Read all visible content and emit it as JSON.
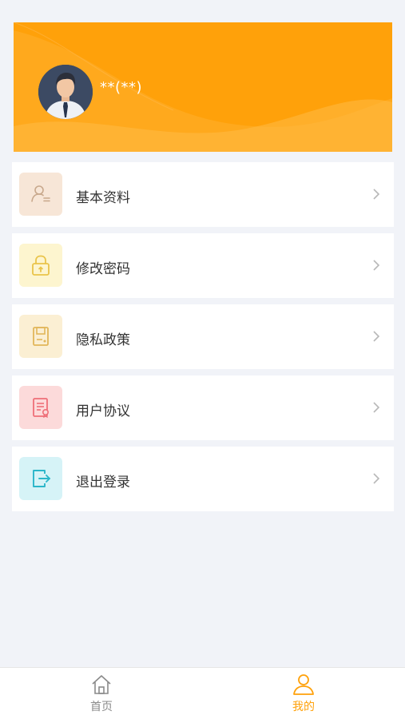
{
  "profile": {
    "username": "**(**)",
    "banner_color": "#ffa10a"
  },
  "menu": [
    {
      "label": "基本资料",
      "icon": "user-profile-icon",
      "bg": "#f7e6d7",
      "fg": "#c8a88c"
    },
    {
      "label": "修改密码",
      "icon": "lock-icon",
      "bg": "#fdf5cf",
      "fg": "#e9c44a"
    },
    {
      "label": "隐私政策",
      "icon": "document-save-icon",
      "bg": "#fbefd3",
      "fg": "#e2b65a"
    },
    {
      "label": "用户协议",
      "icon": "agreement-icon",
      "bg": "#fcdada",
      "fg": "#ee6f78"
    },
    {
      "label": "退出登录",
      "icon": "logout-icon",
      "bg": "#d6f3f7",
      "fg": "#2bb6c9"
    }
  ],
  "tabbar": {
    "home_label": "首页",
    "mine_label": "我的",
    "active_color": "#ffa10a",
    "inactive_color": "#8a8a8a"
  }
}
